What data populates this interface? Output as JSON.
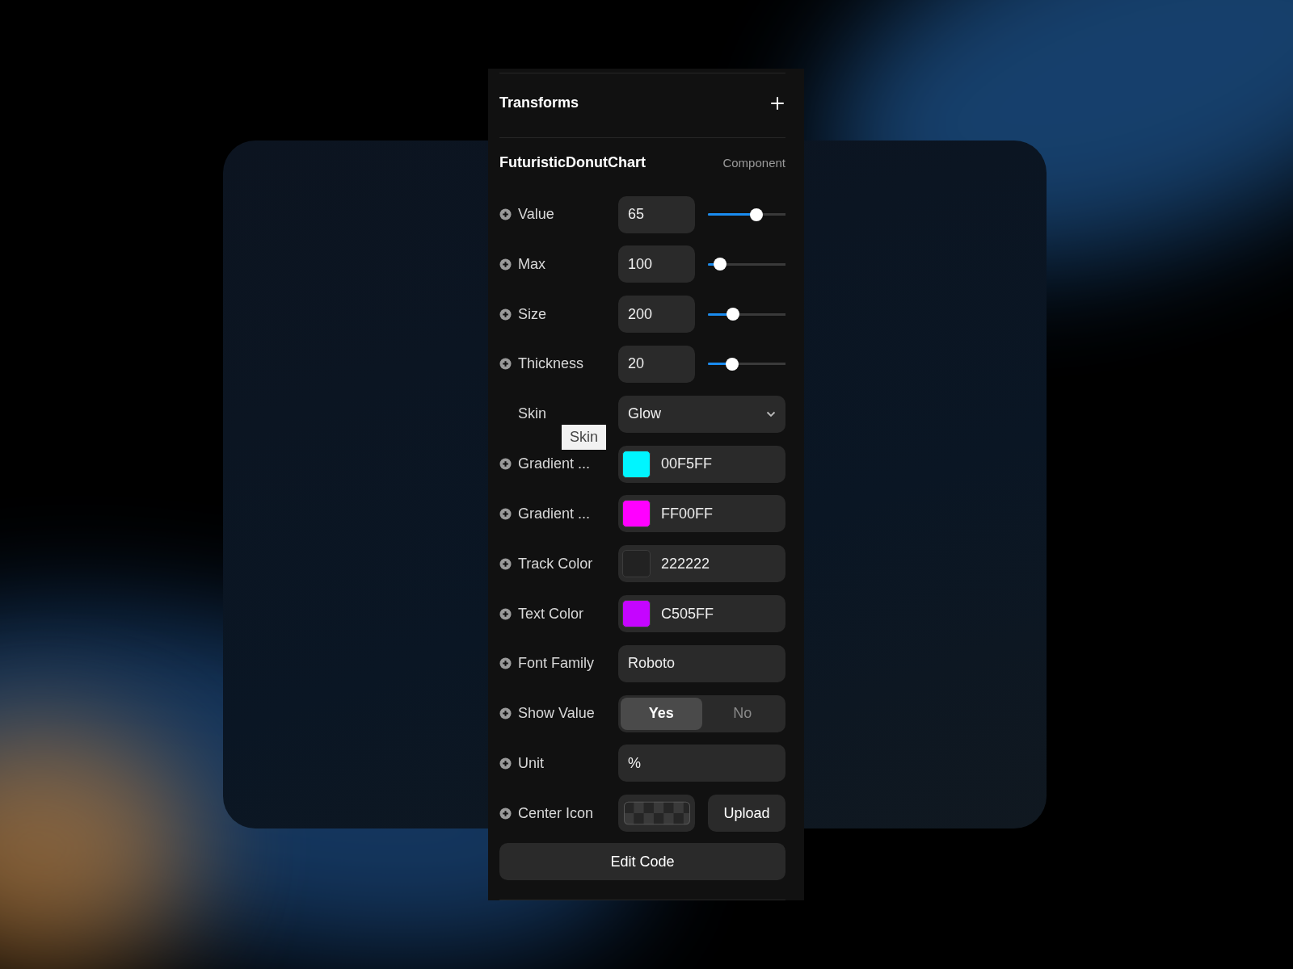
{
  "section": {
    "title": "Transforms"
  },
  "component": {
    "name": "FuturisticDonutChart",
    "type_label": "Component"
  },
  "properties": [
    {
      "kind": "slider",
      "label": "Value",
      "has_add_icon": true,
      "value": "65",
      "level": 0.63
    },
    {
      "kind": "slider",
      "label": "Max",
      "has_add_icon": true,
      "value": "100",
      "level": 0.16
    },
    {
      "kind": "slider",
      "label": "Size",
      "has_add_icon": true,
      "value": "200",
      "level": 0.32
    },
    {
      "kind": "slider",
      "label": "Thickness",
      "has_add_icon": true,
      "value": "20",
      "level": 0.31
    },
    {
      "kind": "select",
      "label": "Skin",
      "has_add_icon": false,
      "value": "Glow",
      "tooltip": "Skin"
    },
    {
      "kind": "color",
      "label": "Gradient ...",
      "has_add_icon": true,
      "value": "00F5FF",
      "color": "#00f5ff"
    },
    {
      "kind": "color",
      "label": "Gradient ...",
      "has_add_icon": true,
      "value": "FF00FF",
      "color": "#ff00ff"
    },
    {
      "kind": "color",
      "label": "Track Color",
      "has_add_icon": true,
      "value": "222222",
      "color": "#222222"
    },
    {
      "kind": "color",
      "label": "Text Color",
      "has_add_icon": true,
      "value": "C505FF",
      "color": "#c505ff"
    },
    {
      "kind": "text",
      "label": "Font Family",
      "has_add_icon": true,
      "value": "Roboto"
    },
    {
      "kind": "toggle",
      "label": "Show Value",
      "has_add_icon": true,
      "options": [
        {
          "label": "Yes",
          "selected": true
        },
        {
          "label": "No",
          "selected": false
        }
      ]
    },
    {
      "kind": "text",
      "label": "Unit",
      "has_add_icon": true,
      "value": "%"
    },
    {
      "kind": "image",
      "label": "Center Icon",
      "has_add_icon": true,
      "button": "Upload"
    }
  ],
  "edit_button": "Edit Code"
}
